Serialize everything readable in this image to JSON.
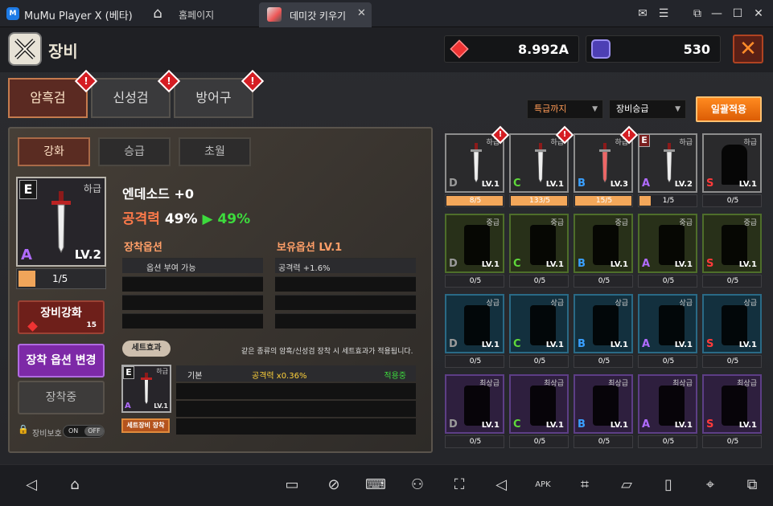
{
  "window": {
    "app_title": "MuMu Player X (베타)",
    "home_tab": "홈페이지",
    "game_tab": "데미갓 키우기"
  },
  "header": {
    "title": "장비",
    "ruby": "8.992A",
    "orb": "530",
    "close_icon": "✕"
  },
  "categories": [
    {
      "label": "암흑검",
      "active": true
    },
    {
      "label": "신성검",
      "active": false
    },
    {
      "label": "방어구",
      "active": false
    }
  ],
  "subtabs": [
    "강화",
    "승급",
    "초월"
  ],
  "item": {
    "grade_letter": "E",
    "rarity": "하급",
    "rank": "A",
    "level": "LV.2",
    "progress_text": "1/5",
    "progress": 0.2,
    "name": "엔데소드 +0",
    "atk_label": "공격력",
    "atk_value": "49%",
    "atk_arrow": "▶",
    "atk_next": "49%"
  },
  "options": {
    "equip_head": "장착옵션",
    "own_head": "보유옵션 LV.1",
    "equip_row1": "옵션 부여 가능",
    "own_row1": "공격력 +1.6%"
  },
  "buttons": {
    "enhance": "장비강화",
    "enhance_cost": "15",
    "change_option": "장착 옵션 변경",
    "equipped": "장착중",
    "protect": "장비보호",
    "toggle_on": "ON",
    "toggle_off": "OFF"
  },
  "set": {
    "button": "세트효과",
    "description": "같은 종류의 암흑/신성검 장착 시 세트효과가 적용됩니다.",
    "card_grade": "E",
    "card_rarity": "하급",
    "card_rank": "A",
    "card_level": "LV.1",
    "equip_button": "세트장비 장착",
    "row_base": "기본",
    "row_effect": "공격력 x0.36%",
    "row_status": "적용중"
  },
  "controls": {
    "grade_filter": "특급까지",
    "target_filter": "장비승급",
    "bulk_apply": "일괄적용"
  },
  "grid": {
    "letters": [
      "D",
      "C",
      "B",
      "A",
      "S"
    ],
    "letter_colors": [
      "#9a9a9a",
      "#5fd93a",
      "#3aa0ff",
      "#b06bff",
      "#ff3a3a"
    ],
    "rows": [
      {
        "grade": "하급",
        "bg": "#2a2a2c",
        "border": "#8d8d8d",
        "levels": [
          "LV.1",
          "LV.1",
          "LV.3",
          "LV.2",
          "LV.1"
        ],
        "counts": [
          "8/5",
          "133/5",
          "15/5",
          "1/5",
          "0/5"
        ],
        "fills": [
          1,
          1,
          1,
          0.2,
          0
        ],
        "alerts": [
          true,
          true,
          true,
          false,
          false
        ],
        "owned": [
          true,
          true,
          true,
          true,
          false
        ]
      },
      {
        "grade": "중급",
        "bg": "#283019",
        "border": "#4e6e2a",
        "levels": [
          "LV.1",
          "LV.1",
          "LV.1",
          "LV.1",
          "LV.1"
        ],
        "counts": [
          "0/5",
          "0/5",
          "0/5",
          "0/5",
          "0/5"
        ]
      },
      {
        "grade": "상급",
        "bg": "#13303e",
        "border": "#2a6a86",
        "levels": [
          "LV.1",
          "LV.1",
          "LV.1",
          "LV.1",
          "LV.1"
        ],
        "counts": [
          "0/5",
          "0/5",
          "0/5",
          "0/5",
          "0/5"
        ]
      },
      {
        "grade": "최상급",
        "bg": "#2e1f3e",
        "border": "#5d3e86",
        "levels": [
          "LV.1",
          "LV.1",
          "LV.1",
          "LV.1",
          "LV.1"
        ],
        "counts": [
          "0/5",
          "0/5",
          "0/5",
          "0/5",
          "0/5"
        ]
      }
    ]
  },
  "bottom_icons": [
    "back-icon",
    "home-icon",
    "camera-icon",
    "gamepad-record-icon",
    "keyboard-icon",
    "gamepad-icon",
    "screenshot-icon",
    "volume-icon",
    "apk-icon",
    "crop-icon",
    "folder-icon",
    "rotate-icon",
    "location-icon",
    "multi-window-icon"
  ]
}
